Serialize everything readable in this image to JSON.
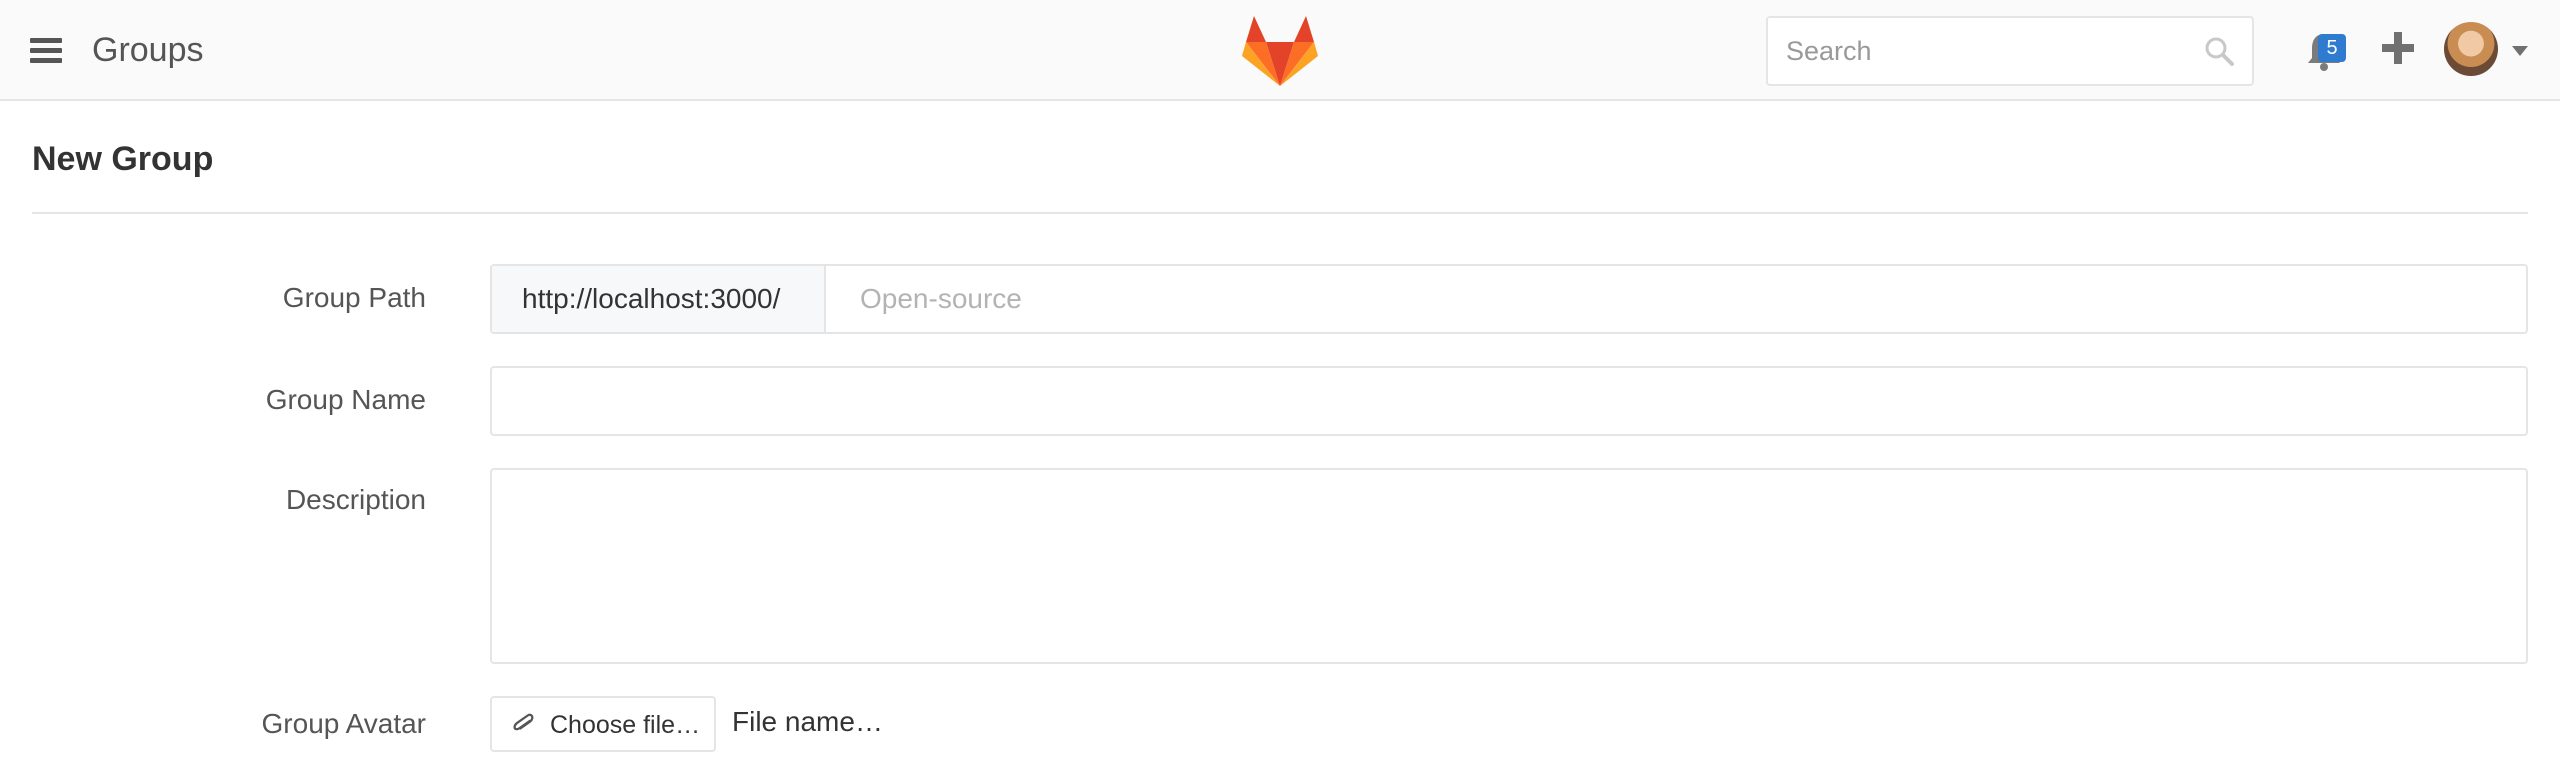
{
  "header": {
    "title": "Groups",
    "search": {
      "placeholder": "Search",
      "value": ""
    },
    "notifications": {
      "count": "5"
    },
    "icons": [
      "hamburger-menu-icon",
      "gitlab-logo-icon",
      "search-icon",
      "bell-icon",
      "plus-icon",
      "avatar",
      "caret-down-icon"
    ]
  },
  "page": {
    "title": "New Group"
  },
  "form": {
    "group_path": {
      "label": "Group Path",
      "prefix": "http://localhost:3000/",
      "placeholder": "Open-source",
      "value": ""
    },
    "group_name": {
      "label": "Group Name",
      "value": ""
    },
    "description": {
      "label": "Description",
      "value": ""
    },
    "avatar": {
      "label": "Group Avatar",
      "button_label": "Choose file…",
      "file_name": "File name…"
    }
  },
  "colors": {
    "header_bg": "#fafafa",
    "badge": "#2e7bcf",
    "border": "#e5e5e5",
    "logo_orange": "#fc6d26",
    "logo_red": "#e24329",
    "logo_yellow": "#fca326"
  }
}
